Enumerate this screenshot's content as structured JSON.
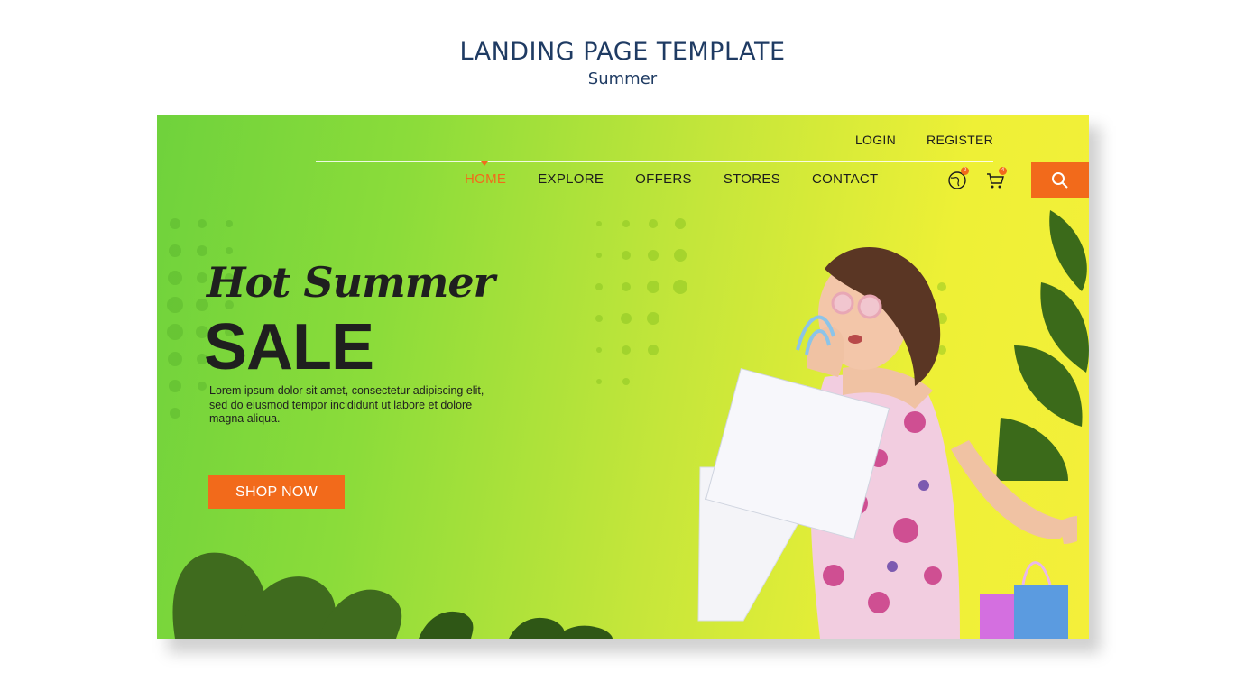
{
  "page": {
    "title": "LANDING PAGE TEMPLATE",
    "subtitle": "Summer"
  },
  "topbar": {
    "login": "LOGIN",
    "register": "REGISTER"
  },
  "nav": {
    "items": [
      {
        "label": "HOME",
        "active": true
      },
      {
        "label": "EXPLORE",
        "active": false
      },
      {
        "label": "OFFERS",
        "active": false
      },
      {
        "label": "STORES",
        "active": false
      },
      {
        "label": "CONTACT",
        "active": false
      }
    ]
  },
  "icons": {
    "wishlist": {
      "name": "globe-icon",
      "badge": "2"
    },
    "cart": {
      "name": "cart-icon",
      "badge": "4"
    },
    "search": {
      "name": "search-icon"
    }
  },
  "hero": {
    "script_title": "Hot Summer",
    "headline": "SALE",
    "body": "Lorem ipsum dolor sit amet, consectetur adipiscing elit, sed do eiusmod tempor incididunt ut labore et dolore magna aliqua.",
    "cta": "SHOP NOW"
  },
  "colors": {
    "accent": "#f26a1b",
    "heading": "#1f3b63",
    "text": "#1f1f1f",
    "gradient_start": "#6fd23c",
    "gradient_end": "#f4ef3a"
  }
}
